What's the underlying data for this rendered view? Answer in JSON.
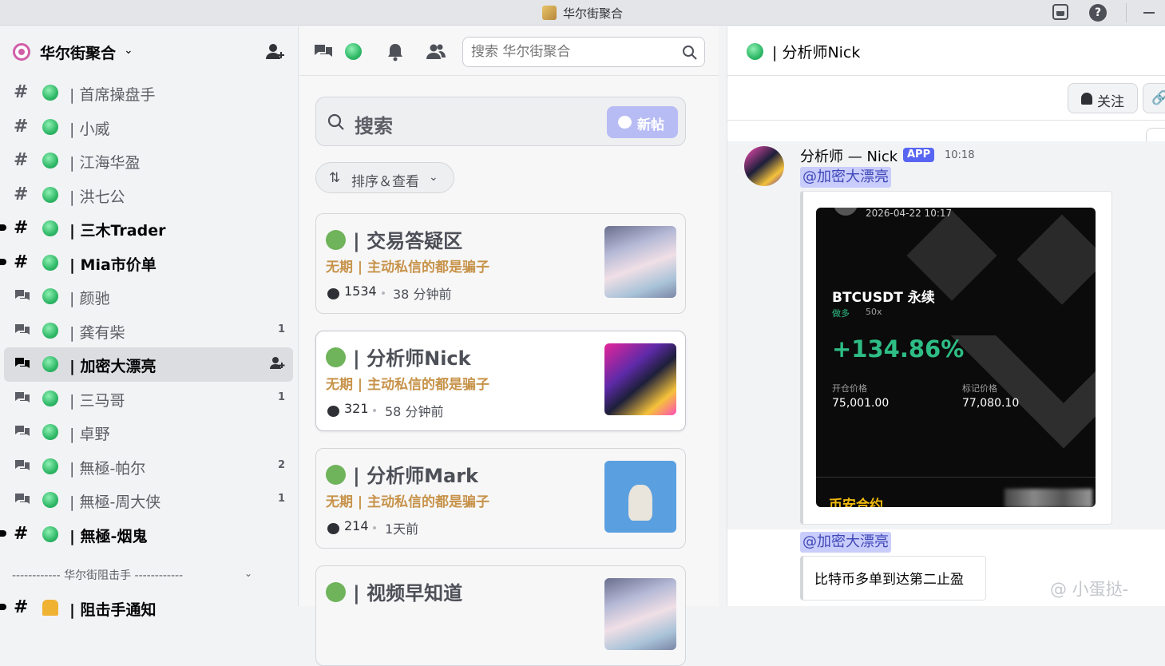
{
  "window": {
    "title": "华尔街聚合"
  },
  "sidebar": {
    "guild_name": "华尔街聚合",
    "channels": [
      {
        "name": "| 首席操盘手",
        "type": "text",
        "unread": false,
        "badge": ""
      },
      {
        "name": "| 小威",
        "type": "text",
        "unread": false,
        "badge": ""
      },
      {
        "name": "| 江海华盈",
        "type": "text",
        "unread": false,
        "badge": ""
      },
      {
        "name": "| 洪七公",
        "type": "text",
        "unread": false,
        "badge": ""
      },
      {
        "name": "| 三木Trader",
        "type": "text",
        "unread": true,
        "badge": ""
      },
      {
        "name": "| Mia市价单",
        "type": "text",
        "unread": true,
        "badge": ""
      },
      {
        "name": "| 颜驰",
        "type": "forum",
        "unread": false,
        "badge": ""
      },
      {
        "name": "| 龚有柴",
        "type": "forum",
        "unread": false,
        "badge": "1"
      },
      {
        "name": "| 加密大漂亮",
        "type": "forum",
        "unread": false,
        "badge": "",
        "selected": true
      },
      {
        "name": "| 三马哥",
        "type": "forum",
        "unread": false,
        "badge": "1"
      },
      {
        "name": "| 卓野",
        "type": "forum",
        "unread": false,
        "badge": ""
      },
      {
        "name": "| 無極-帕尔",
        "type": "forum",
        "unread": false,
        "badge": "2"
      },
      {
        "name": "| 無極-周大侠",
        "type": "forum",
        "unread": false,
        "badge": "1"
      },
      {
        "name": "| 無極-烟鬼",
        "type": "text",
        "unread": true,
        "badge": ""
      }
    ],
    "category_label": "------------ 华尔街阻击手 ------------",
    "partial_channel": "| 阻击手通知"
  },
  "forum": {
    "search_placeholder": "搜索 华尔街聚合",
    "post_search_label": "搜索",
    "new_post_label": "新帖",
    "sort_label": "排序＆查看",
    "posts": [
      {
        "title": "| 交易答疑区",
        "tag": "无期 | 主动私信的都是骗子",
        "count": "1534",
        "time": "38 分钟前"
      },
      {
        "title": "| 分析师Nick",
        "tag": "无期 | 主动私信的都是骗子",
        "count": "321",
        "time": "58 分钟前"
      },
      {
        "title": "| 分析师Mark",
        "tag": "无期 | 主动私信的都是骗子",
        "count": "214",
        "time": "1天前"
      },
      {
        "title": "| 视频早知道",
        "tag": "",
        "count": "",
        "time": ""
      }
    ]
  },
  "thread": {
    "title": "| 分析师Nick",
    "follow_label": "关注",
    "message": {
      "author": "分析师 — Nick",
      "badge": "APP",
      "time": "10:18",
      "mention": "@加密大漂亮"
    },
    "pnl_card": {
      "date": "2026-04-22 10:17",
      "pair": "BTCUSDT 永续",
      "side": "做多",
      "leverage": "50x",
      "pnl_percent": "+134.86%",
      "entry_label": "开仓价格",
      "entry_value": "75,001.00",
      "mark_label": "标记价格",
      "mark_value": "77,080.10",
      "brand": "币安合约"
    },
    "reply_mention": "@加密大漂亮",
    "reply_text": "比特币多单到达第二止盈",
    "watermark": "@ 小蛋挞-"
  },
  "colors": {
    "accent": "#5865f2",
    "online_green": "#2fb867",
    "tag_gold": "#c7934a",
    "profit_green": "#2ebd85"
  }
}
